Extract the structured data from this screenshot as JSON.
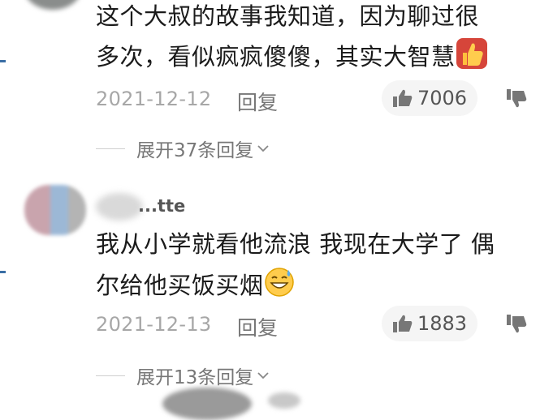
{
  "comments": [
    {
      "username": "",
      "text_lines": [
        "这个大叔的故事我知道，因为聊过很",
        "多次，看似疯疯傻傻，其实大智慧"
      ],
      "emoji": "thumbs-up-emoji",
      "date": "2021-12-12",
      "reply_label": "回复",
      "likes": "7006",
      "expand_label": "展开37条回复"
    },
    {
      "username": "...tte",
      "text_lines": [
        "我从小学就看他流浪 我现在大学了 偶",
        "尔给他买饭买烟"
      ],
      "emoji": "grinning-sweat-emoji",
      "date": "2021-12-13",
      "reply_label": "回复",
      "likes": "1883",
      "expand_label": "展开13条回复"
    }
  ],
  "icons": {
    "like": "thumbs-up-icon",
    "dislike": "thumbs-down-icon",
    "expand": "chevron-down-icon"
  },
  "colors": {
    "text": "#1b1b1b",
    "muted": "#a7a7a7",
    "pill": "#f5f5f5"
  }
}
